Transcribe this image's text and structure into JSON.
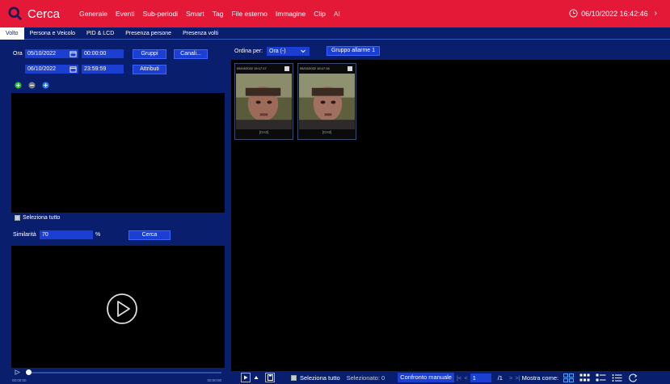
{
  "app": {
    "title": "Cerca"
  },
  "top_menu": [
    "Generale",
    "Eventi",
    "Sub-periodi",
    "Smart",
    "Tag",
    "File esterno",
    "Immagine",
    "Clip",
    "AI"
  ],
  "datetime": "06/10/2022 16:42:46",
  "more_glyph": "›",
  "subtabs": [
    "Volto",
    "Persona e Veicolo",
    "PID & LCD",
    "Presenza persone",
    "Presenza volti"
  ],
  "filter": {
    "ora_label": "Ora",
    "start_date": "05/10/2022",
    "start_time": "00:00:00",
    "end_date": "06/10/2022",
    "end_time": "23:59:59",
    "gruppi_label": "Gruppi",
    "canali_label": "Canali...",
    "attributi_label": "Attributi"
  },
  "select_all_label": "Seleziona tutto",
  "similarity": {
    "label": "Similarità",
    "value": "70",
    "unit": "%"
  },
  "search_button": "Cerca",
  "timeline": {
    "start": "00:00:00",
    "end": "00:00:00",
    "progress": 0.0
  },
  "results": {
    "sort_label": "Ordina per:",
    "sort_value": "Ora (-)",
    "group_label": "Gruppo allarme 1",
    "items": [
      {
        "timestamp": "05/10/2022 15:17:17",
        "channel": "[CH2]"
      },
      {
        "timestamp": "05/10/2022 15:17:16",
        "channel": "[CH2]"
      }
    ]
  },
  "bottom": {
    "select_all": "Seleziona tutto",
    "selected": "Selezionato: 0",
    "manual_compare": "Confronto manuale",
    "page_input": "1",
    "page_total": "/1",
    "show_as": "Mostra come:"
  },
  "colors": {
    "header_red": "#e31937",
    "panel_blue": "#0a1e6e",
    "field_blue": "#1b3fd0"
  }
}
